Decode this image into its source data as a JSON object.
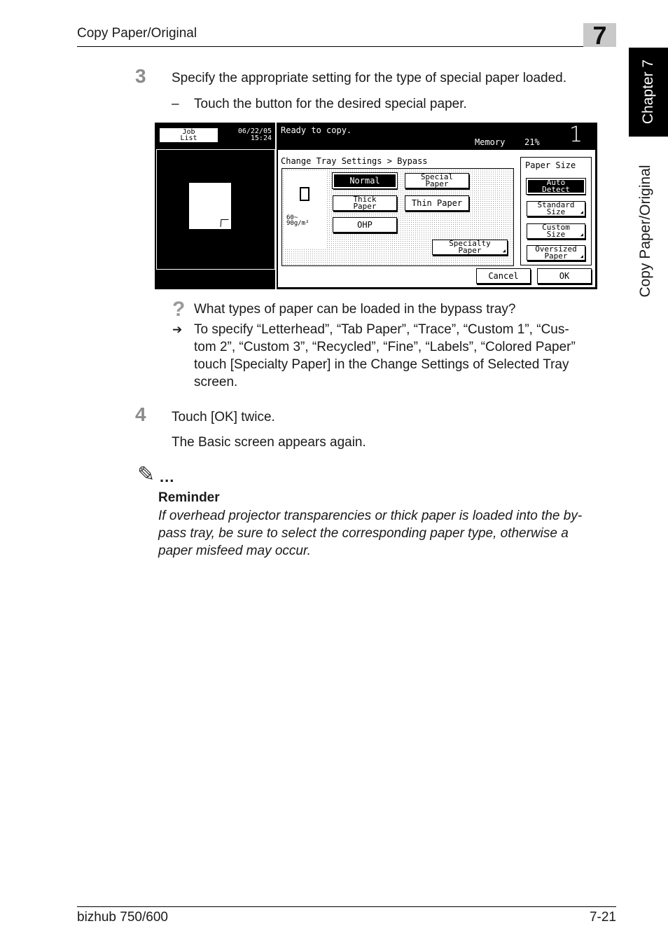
{
  "header": {
    "title": "Copy Paper/Original",
    "chapter_number": "7"
  },
  "side_tab": {
    "chapter_label": "Chapter 7",
    "section_label": "Copy Paper/Original"
  },
  "step3": {
    "number": "3",
    "text": "Specify the appropriate setting for the type of special paper loaded.",
    "sub_dash": "–",
    "sub_text": "Touch the button for the desired special paper."
  },
  "screen": {
    "job_list": "Job List",
    "date": "06/22/05",
    "time": "15:24",
    "status": "Ready to copy.",
    "memory_label": "Memory",
    "memory_value": "21%",
    "copies": "1",
    "breadcrumb": "Change Tray Settings > Bypass",
    "weight": "60~ 90g/m²",
    "btn_normal": "Normal",
    "btn_special": "Special Paper",
    "btn_thick": "Thick Paper",
    "btn_thin": "Thin Paper",
    "btn_ohp": "OHP",
    "btn_specialty": "Specialty Paper",
    "paper_size_title": "Paper Size",
    "btn_auto": "Auto Detect",
    "btn_standard": "Standard Size",
    "btn_custom": "Custom Size",
    "btn_oversized": "Oversized Paper",
    "btn_cancel": "Cancel",
    "btn_ok": "OK"
  },
  "hint": {
    "question_icon": "?",
    "question": "What types of paper can be loaded in the bypass tray?",
    "arrow_icon": "➔",
    "answer_lines": [
      "To specify “Letterhead”, “Tab Paper”, “Trace”, “Custom 1”, “Cus-",
      "tom 2”, “Custom 3”, “Recycled”, “Fine”, “Labels”, “Colored Paper”",
      "touch [Specialty Paper] in the Change Settings of Selected Tray",
      "screen."
    ]
  },
  "step4": {
    "number": "4",
    "text": "Touch [OK] twice.",
    "result": "The Basic screen appears again."
  },
  "reminder": {
    "icon": "pencil-note-icon",
    "icon_glyph": "✎",
    "dots": "...",
    "title": "Reminder",
    "lines": [
      "If overhead projector transparencies or thick paper is loaded into the by-",
      "pass tray, be sure to select the corresponding paper type, otherwise a",
      "paper misfeed may occur."
    ]
  },
  "footer": {
    "model": "bizhub 750/600",
    "page": "7-21"
  }
}
